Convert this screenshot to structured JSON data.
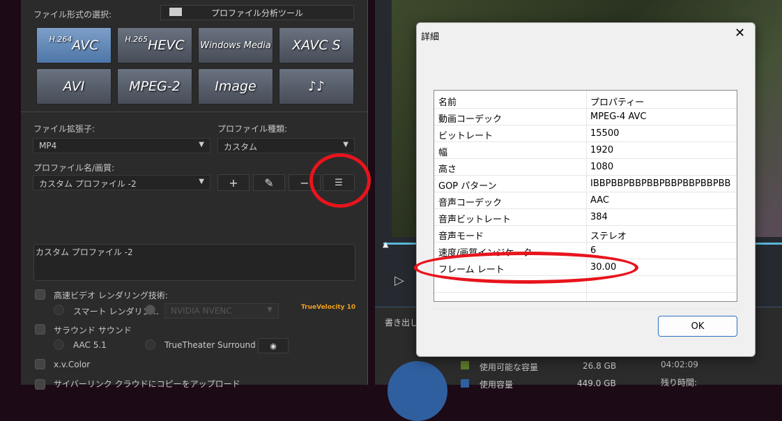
{
  "left": {
    "format_label": "ファイル形式の選択:",
    "analyzer_button": "プロファイル分析ツール",
    "formats": [
      {
        "sup": "H.264",
        "label": "AVC"
      },
      {
        "sup": "H.265",
        "label": "HEVC"
      },
      {
        "sup": "",
        "label": "Windows Media"
      },
      {
        "sup": "",
        "label": "XAVC S"
      },
      {
        "sup": "",
        "label": "AVI"
      },
      {
        "sup": "",
        "label": "MPEG-2"
      },
      {
        "sup": "",
        "label": "Image"
      },
      {
        "sup": "",
        "label": "♪♪"
      }
    ],
    "ext_label": "ファイル拡張子:",
    "ext_value": "MP4",
    "ptype_label": "プロファイル種類:",
    "ptype_value": "カスタム",
    "pname_label": "プロファイル名/画質:",
    "pname_value": "カスタム プロファイル -2",
    "desc": "カスタム プロファイル -2",
    "hw_label": "高速ビデオ レンダリング技術:",
    "smart_label": "スマート レンダリン...",
    "gpu_value": "NVIDIA NVENC",
    "tv_logo": "TrueVelocity 10",
    "surround_label": "サラウンド サウンド",
    "aac_label": "AAC 5.1",
    "tt_label": "TrueTheater Surround",
    "xv_label": "x.v.Color",
    "cloud_label": "サイバーリンク クラウドにコピーをアップロード"
  },
  "right": {
    "export_label": "書き出し先",
    "avail_label": "使用可能な容量",
    "avail_value": "26.8  GB",
    "used_label": "使用容量",
    "used_value": "449.0  GB",
    "time": "04:02:09",
    "remain_label": "残り時間:",
    "colors": {
      "avail": "#5a7a2a",
      "used": "#2f5f9f"
    }
  },
  "dialog": {
    "title": "詳細",
    "header": [
      "名前",
      "プロパティー"
    ],
    "rows": [
      [
        "動画コーデック",
        "MPEG-4 AVC"
      ],
      [
        "ビットレート",
        "15500"
      ],
      [
        "幅",
        "1920"
      ],
      [
        "高さ",
        "1080"
      ],
      [
        "GOP パターン",
        "IBBPBBPBBPBBPBBPBBPBBPBB"
      ],
      [
        "音声コーデック",
        "AAC"
      ],
      [
        "音声ビットレート",
        "384"
      ],
      [
        "音声モード",
        "ステレオ"
      ],
      [
        "速度/画質インジケーター",
        "6"
      ],
      [
        "フレーム レート",
        "30.00"
      ]
    ],
    "ok": "OK"
  }
}
